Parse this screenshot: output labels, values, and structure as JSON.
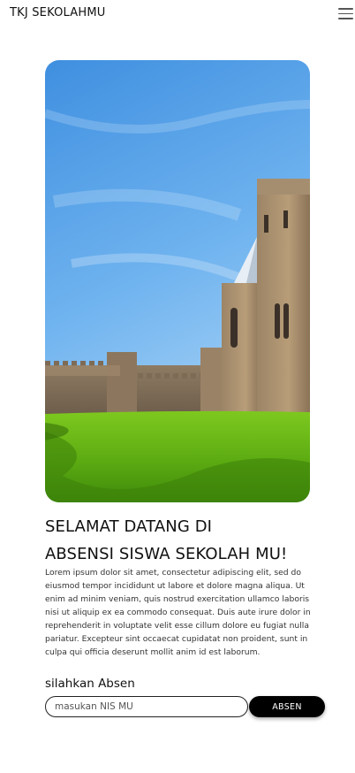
{
  "navbar": {
    "brand": "TKJ SEKOLAHMU",
    "menu_icon": "hamburger-menu-icon"
  },
  "hero": {
    "image_subject": "castle on green lawn under blue sky"
  },
  "main": {
    "headline_line1": "SELAMAT DATANG DI",
    "headline_line2": "ABSENSI SISWA SEKOLAH MU!",
    "paragraph": "Lorem ipsum dolor sit amet, consectetur adipiscing elit, sed do eiusmod tempor incididunt ut labore et dolore magna aliqua. Ut enim ad minim veniam, quis nostrud exercitation ullamco laboris nisi ut aliquip ex ea commodo consequat. Duis aute irure dolor in reprehenderit in voluptate velit esse cillum dolore eu fugiat nulla pariatur. Excepteur sint occaecat cupidatat non proident, sunt in culpa qui officia deserunt mollit anim id est laborum."
  },
  "form": {
    "label": "silahkan Absen",
    "input_placeholder": "masukan NIS MU",
    "input_value": "",
    "button_label": "ABSEN"
  },
  "colors": {
    "text": "#111111",
    "button_bg": "#000000",
    "button_text": "#ffffff"
  }
}
